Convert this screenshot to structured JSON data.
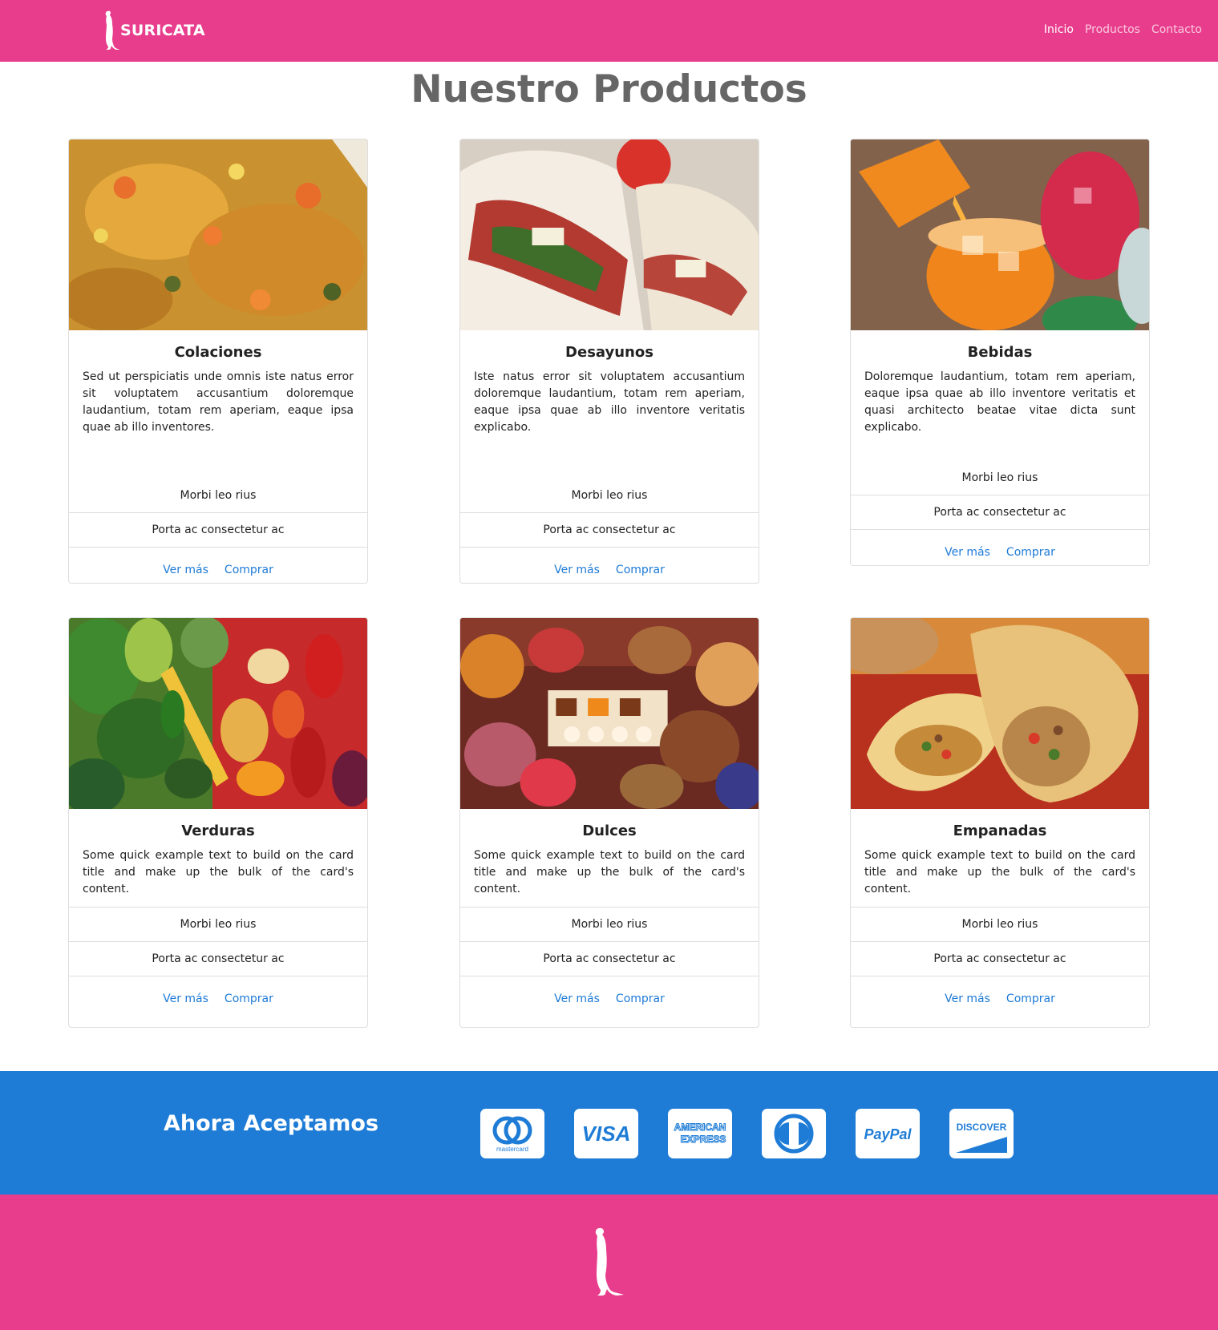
{
  "navbar": {
    "brand": "SURICATA",
    "links": [
      {
        "label": "Inicio",
        "active": true
      },
      {
        "label": "Productos",
        "active": false
      },
      {
        "label": "Contacto",
        "active": false
      }
    ]
  },
  "page_title": "Nuestro Productos",
  "cards": [
    {
      "title": "Colaciones",
      "text": "Sed ut perspiciatis unde omnis iste natus error sit voluptatem accusantium doloremque laudantium, totam rem aperiam, eaque ipsa quae ab illo inventores.",
      "item1": "Morbi leo rius",
      "item2": "Porta ac consectetur ac",
      "link1": "Ver más",
      "link2": "Comprar"
    },
    {
      "title": "Desayunos",
      "text": "Iste natus error sit voluptatem accusantium doloremque laudantium, totam rem aperiam, eaque ipsa quae ab illo inventore veritatis explicabo.",
      "item1": "Morbi leo rius",
      "item2": "Porta ac consectetur ac",
      "link1": "Ver más",
      "link2": "Comprar"
    },
    {
      "title": "Bebidas",
      "text": "Doloremque laudantium, totam rem aperiam, eaque ipsa quae ab illo inventore veritatis et quasi architecto beatae vitae dicta sunt explicabo.",
      "item1": "Morbi leo rius",
      "item2": "Porta ac consectetur ac",
      "link1": "Ver más",
      "link2": "Comprar"
    },
    {
      "title": "Verduras",
      "text": "Some quick example text to build on the card title and make up the bulk of the card's content.",
      "item1": "Morbi leo rius",
      "item2": "Porta ac consectetur ac",
      "link1": "Ver más",
      "link2": "Comprar"
    },
    {
      "title": "Dulces",
      "text": "Some quick example text to build on the card title and make up the bulk of the card's content.",
      "item1": "Morbi leo rius",
      "item2": "Porta ac consectetur ac",
      "link1": "Ver más",
      "link2": "Comprar"
    },
    {
      "title": "Empanadas",
      "text": "Some quick example text to build on the card title and make up the bulk of the card's content.",
      "item1": "Morbi leo rius",
      "item2": "Porta ac consectetur ac",
      "link1": "Ver más",
      "link2": "Comprar"
    }
  ],
  "payment": {
    "title": "Ahora Aceptamos",
    "methods": [
      {
        "name": "mastercard",
        "icon": "mastercard-icon",
        "label": "mastercard"
      },
      {
        "name": "visa",
        "icon": "visa-icon",
        "label": "VISA"
      },
      {
        "name": "american-express",
        "icon": "amex-icon",
        "label": "AMERICAN EXPRESS"
      },
      {
        "name": "diners-club",
        "icon": "diners-club-icon",
        "label": ""
      },
      {
        "name": "paypal",
        "icon": "paypal-icon",
        "label": "PayPal"
      },
      {
        "name": "discover",
        "icon": "discover-icon",
        "label": "DISCOVER"
      }
    ]
  },
  "colors": {
    "brand_pink": "#e83d8c",
    "accent_blue": "#1e7cd6",
    "link_blue": "#1e7ad6",
    "heading_gray": "#666666"
  }
}
